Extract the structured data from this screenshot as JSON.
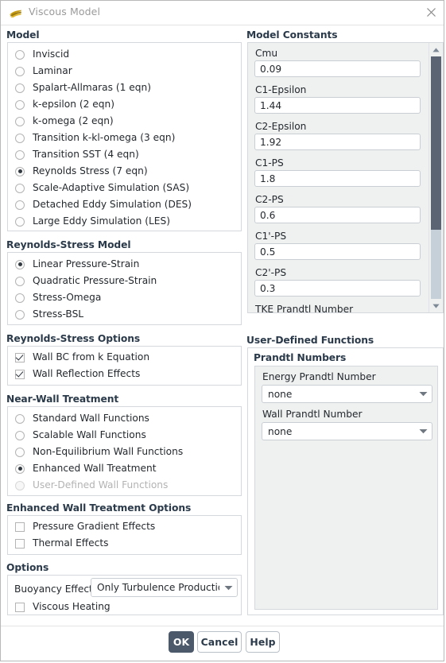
{
  "window": {
    "title": "Viscous Model",
    "icon": "fluent-logo-icon",
    "close_icon": "close-icon"
  },
  "model": {
    "title": "Model",
    "options": [
      {
        "label": "Inviscid",
        "selected": false
      },
      {
        "label": "Laminar",
        "selected": false
      },
      {
        "label": "Spalart-Allmaras (1 eqn)",
        "selected": false
      },
      {
        "label": "k-epsilon (2 eqn)",
        "selected": false
      },
      {
        "label": "k-omega (2 eqn)",
        "selected": false
      },
      {
        "label": "Transition k-kl-omega (3 eqn)",
        "selected": false
      },
      {
        "label": "Transition SST (4 eqn)",
        "selected": false
      },
      {
        "label": "Reynolds Stress (7 eqn)",
        "selected": true
      },
      {
        "label": "Scale-Adaptive Simulation (SAS)",
        "selected": false
      },
      {
        "label": "Detached Eddy Simulation (DES)",
        "selected": false
      },
      {
        "label": "Large Eddy Simulation (LES)",
        "selected": false
      }
    ]
  },
  "reynolds_stress_model": {
    "title": "Reynolds-Stress Model",
    "options": [
      {
        "label": "Linear Pressure-Strain",
        "selected": true
      },
      {
        "label": "Quadratic Pressure-Strain",
        "selected": false
      },
      {
        "label": "Stress-Omega",
        "selected": false
      },
      {
        "label": "Stress-BSL",
        "selected": false
      }
    ]
  },
  "reynolds_stress_options": {
    "title": "Reynolds-Stress Options",
    "options": [
      {
        "label": "Wall BC from k Equation",
        "checked": true
      },
      {
        "label": "Wall Reflection Effects",
        "checked": true
      }
    ]
  },
  "near_wall_treatment": {
    "title": "Near-Wall Treatment",
    "options": [
      {
        "label": "Standard Wall Functions",
        "selected": false,
        "disabled": false
      },
      {
        "label": "Scalable Wall Functions",
        "selected": false,
        "disabled": false
      },
      {
        "label": "Non-Equilibrium Wall Functions",
        "selected": false,
        "disabled": false
      },
      {
        "label": "Enhanced Wall Treatment",
        "selected": true,
        "disabled": false
      },
      {
        "label": "User-Defined Wall Functions",
        "selected": false,
        "disabled": true
      }
    ]
  },
  "enhanced_wall_treatment_options": {
    "title": "Enhanced Wall Treatment Options",
    "options": [
      {
        "label": "Pressure Gradient Effects",
        "checked": false
      },
      {
        "label": "Thermal Effects",
        "checked": false
      }
    ]
  },
  "options": {
    "title": "Options",
    "buoyancy_effects_label": "Buoyancy Effects",
    "buoyancy_effects_value": "Only Turbulence Production",
    "viscous_heating": {
      "label": "Viscous Heating",
      "checked": false
    }
  },
  "model_constants": {
    "title": "Model Constants",
    "fields": [
      {
        "label": "Cmu",
        "value": "0.09"
      },
      {
        "label": "C1-Epsilon",
        "value": "1.44"
      },
      {
        "label": "C2-Epsilon",
        "value": "1.92"
      },
      {
        "label": "C1-PS",
        "value": "1.8"
      },
      {
        "label": "C2-PS",
        "value": "0.6"
      },
      {
        "label": "C1'-PS",
        "value": "0.5"
      },
      {
        "label": "C2'-PS",
        "value": "0.3"
      }
    ],
    "partial_label": "TKE Prandtl Number"
  },
  "user_defined_functions": {
    "title": "User-Defined Functions",
    "prandtl_numbers": {
      "title": "Prandtl Numbers",
      "fields": [
        {
          "label": "Energy Prandtl Number",
          "value": "none"
        },
        {
          "label": "Wall Prandtl Number",
          "value": "none"
        }
      ]
    }
  },
  "footer": {
    "ok": "OK",
    "cancel": "Cancel",
    "help": "Help"
  }
}
